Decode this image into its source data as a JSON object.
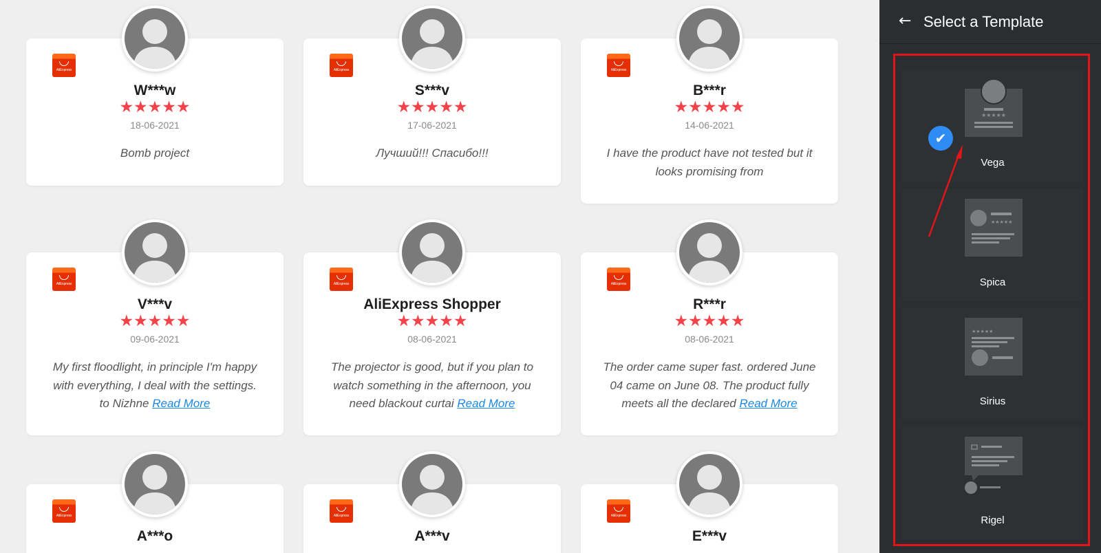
{
  "reviews": [
    {
      "name": "W***w",
      "stars": "★★★★★",
      "date": "18-06-2021",
      "text": "Bomb project",
      "read_more": ""
    },
    {
      "name": "S***v",
      "stars": "★★★★★",
      "date": "17-06-2021",
      "text": "Лучший!!! Спасибо!!!",
      "read_more": ""
    },
    {
      "name": "B***r",
      "stars": "★★★★★",
      "date": "14-06-2021",
      "text": "I have the product have not tested but it looks promising from",
      "read_more": ""
    },
    {
      "name": "V***v",
      "stars": "★★★★★",
      "date": "09-06-2021",
      "text": "My first floodlight, in principle I'm happy with everything, I deal with the settings. to Nizhne ",
      "read_more": "Read More"
    },
    {
      "name": "AliExpress Shopper",
      "stars": "★★★★★",
      "date": "08-06-2021",
      "text": "The projector is good, but if you plan to watch something in the afternoon, you need blackout curtai ",
      "read_more": "Read More"
    },
    {
      "name": "R***r",
      "stars": "★★★★★",
      "date": "08-06-2021",
      "text": "The order came super fast. ordered June 04 came on June 08. The product fully meets all the declared ",
      "read_more": "Read More"
    },
    {
      "name": "A***o",
      "stars": "",
      "date": "",
      "text": "",
      "read_more": ""
    },
    {
      "name": "A***v",
      "stars": "",
      "date": "",
      "text": "",
      "read_more": ""
    },
    {
      "name": "E***v",
      "stars": "",
      "date": "",
      "text": "",
      "read_more": ""
    }
  ],
  "logo_text": "AliExpress",
  "sidebar": {
    "title": "Select a Template",
    "back_icon": "arrow-left-icon",
    "templates": [
      {
        "label": "Vega",
        "selected": true
      },
      {
        "label": "Spica",
        "selected": false
      },
      {
        "label": "Sirius",
        "selected": false
      },
      {
        "label": "Rigel",
        "selected": false
      }
    ],
    "check_icon": "check-icon"
  },
  "colors": {
    "star": "#f2434a",
    "link": "#1e88e5",
    "highlight": "#e0161b",
    "check": "#2f8cf4",
    "sidebar_bg": "#2a2e31"
  }
}
